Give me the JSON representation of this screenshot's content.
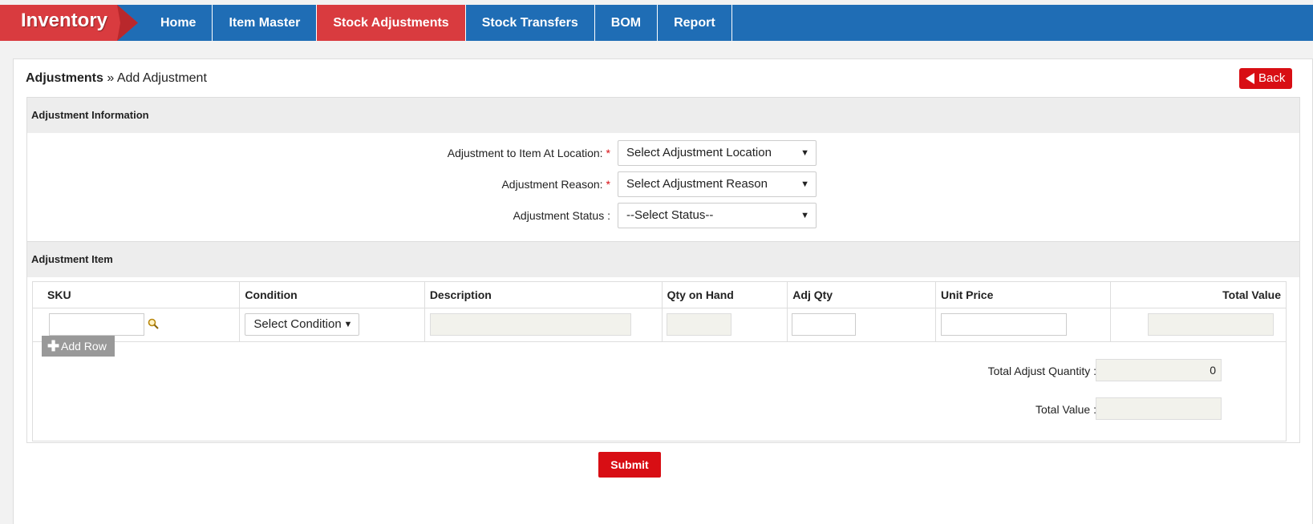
{
  "app": {
    "brand": "Inventory"
  },
  "nav": [
    {
      "label": "Home"
    },
    {
      "label": "Item Master"
    },
    {
      "label": "Stock Adjustments"
    },
    {
      "label": "Stock Transfers"
    },
    {
      "label": "BOM"
    },
    {
      "label": "Report"
    }
  ],
  "breadcrumb": {
    "parent": "Adjustments",
    "separator": "»",
    "current": "Add Adjustment"
  },
  "back_button": {
    "label": "Back"
  },
  "adjustment_info": {
    "title": "Adjustment Information",
    "location": {
      "label": "Adjustment to Item At Location:",
      "required": "*",
      "value": "Select Adjustment Location"
    },
    "reason": {
      "label": "Adjustment Reason:",
      "required": "*",
      "value": "Select Adjustment Reason"
    },
    "status": {
      "label": "Adjustment Status :",
      "value": "--Select Status--"
    }
  },
  "adjustment_item": {
    "title": "Adjustment Item",
    "columns": [
      "SKU",
      "Condition",
      "Description",
      "Qty on Hand",
      "Adj Qty",
      "Unit Price",
      "Total Value"
    ],
    "row": {
      "condition": "Select Condition",
      "sku": "",
      "description": "",
      "qty_on_hand": "",
      "adj_qty": "",
      "unit_price": "",
      "total_value": ""
    },
    "add_row": "Add Row",
    "total_adjust_quantity": {
      "label": "Total Adjust Quantity :",
      "value": "0"
    },
    "total_value": {
      "label": "Total Value :",
      "value": ""
    }
  },
  "submit": {
    "label": "Submit"
  },
  "colors": {
    "nav_blue": "#1f6db5",
    "active_red": "#d93b3f",
    "button_red": "#d80e14"
  },
  "icons": {
    "search": "search-icon",
    "back": "triangle-left-icon",
    "add": "plus-icon",
    "dropdown": "caret-down-icon"
  }
}
